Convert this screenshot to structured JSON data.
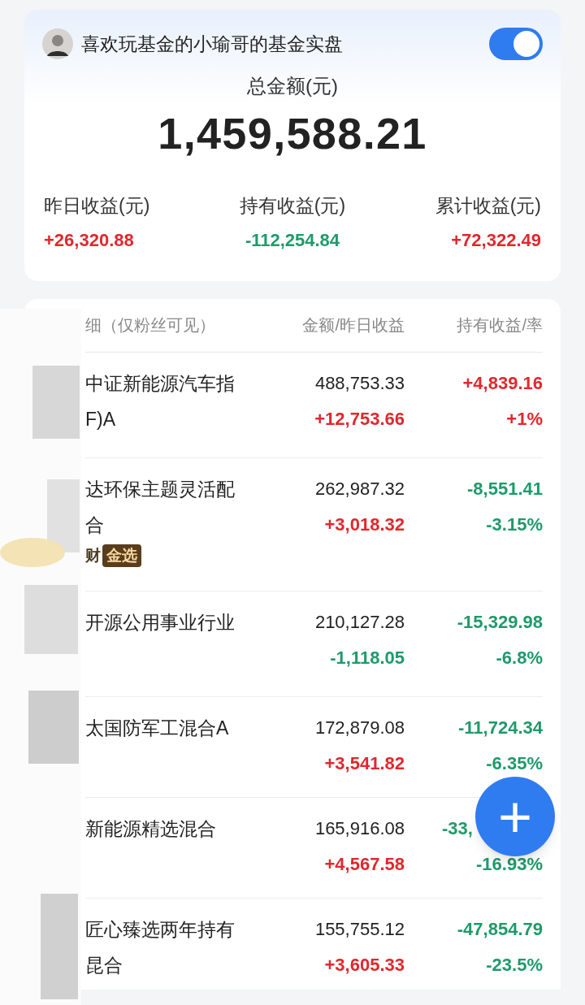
{
  "header": {
    "title": "喜欢玩基金的小瑜哥的基金实盘",
    "toggle_on": true
  },
  "total": {
    "label": "总金额(元)",
    "value": "1,459,588.21"
  },
  "stats": [
    {
      "label": "昨日收益(元)",
      "value": "+26,320.88",
      "color": "#e0282e"
    },
    {
      "label": "持有收益(元)",
      "value": "-112,254.84",
      "color": "#1f9a6a"
    },
    {
      "label": "累计收益(元)",
      "value": "+72,322.49",
      "color": "#e0282e"
    }
  ],
  "table": {
    "columns": [
      "细（仅粉丝可见）",
      "金额/昨日收益",
      "持有收益/率"
    ],
    "rows": [
      {
        "name": [
          "中证新能源汽车指",
          "F)A"
        ],
        "amount": "488,753.33",
        "daily": {
          "value": "+12,753.66",
          "color": "#e0282e"
        },
        "holding": {
          "value": "+4,839.16",
          "color": "#e0282e"
        },
        "rate": {
          "value": "+1%",
          "color": "#e0282e"
        }
      },
      {
        "name": [
          "达环保主题灵活配",
          "合"
        ],
        "badge": {
          "prefix": "财",
          "label": "金选"
        },
        "amount": "262,987.32",
        "daily": {
          "value": "+3,018.32",
          "color": "#e0282e"
        },
        "holding": {
          "value": "-8,551.41",
          "color": "#1f9a6a"
        },
        "rate": {
          "value": "-3.15%",
          "color": "#1f9a6a"
        }
      },
      {
        "name": [
          "开源公用事业行业"
        ],
        "amount": "210,127.28",
        "daily": {
          "value": "-1,118.05",
          "color": "#1f9a6a"
        },
        "holding": {
          "value": "-15,329.98",
          "color": "#1f9a6a"
        },
        "rate": {
          "value": "-6.8%",
          "color": "#1f9a6a"
        }
      },
      {
        "name": [
          "太国防军工混合A"
        ],
        "amount": "172,879.08",
        "daily": {
          "value": "+3,541.82",
          "color": "#e0282e"
        },
        "holding": {
          "value": "-11,724.34",
          "color": "#1f9a6a"
        },
        "rate": {
          "value": "-6.35%",
          "color": "#1f9a6a"
        }
      },
      {
        "name": [
          "新能源精选混合"
        ],
        "amount": "165,916.08",
        "daily": {
          "value": "+4,567.58",
          "color": "#e0282e"
        },
        "holding": {
          "value": "-33,",
          "color": "#1f9a6a",
          "cut_by_button": true
        },
        "rate": {
          "value": "-16.93%",
          "color": "#1f9a6a"
        }
      },
      {
        "name": [
          "匠心臻选两年持有",
          "昆合"
        ],
        "amount": "155,755.12",
        "daily": {
          "value": "+3,605.33",
          "color": "#e0282e"
        },
        "holding": {
          "value": "-47,854.79",
          "color": "#1f9a6a"
        },
        "rate": {
          "value": "-23.5%",
          "color": "#1f9a6a"
        }
      }
    ]
  },
  "fab": {
    "symbol": "+"
  }
}
